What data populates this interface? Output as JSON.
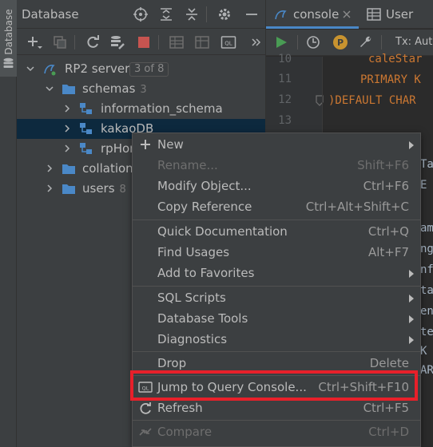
{
  "strip": {
    "label": "Database"
  },
  "db_panel": {
    "title": "Database",
    "tree": {
      "server": {
        "label": "RP2 server",
        "badge": "3 of 8"
      },
      "schemas": {
        "label": "schemas",
        "count": "3"
      },
      "items": [
        {
          "label": "information_schema"
        },
        {
          "label": "kakaoDB"
        },
        {
          "label": "rpHom"
        }
      ],
      "collations": {
        "label": "collations"
      },
      "users": {
        "label": "users",
        "count": "8"
      }
    }
  },
  "editor": {
    "tabs": [
      {
        "label": "console"
      },
      {
        "label": "User"
      }
    ],
    "tx_label": "Tx: Auto",
    "line_numbers": [
      "10",
      "11",
      "12",
      "13"
    ],
    "code_lines": [
      "caleStar",
      "PRIMARY K",
      ")DEFAULT CHAR"
    ],
    "peek_chars": [
      "Ta",
      "E",
      "am",
      "ng",
      "nf",
      "ta",
      "en",
      "te",
      "K",
      "AR"
    ]
  },
  "menu": {
    "items": [
      {
        "label": "New",
        "shortcut": "",
        "submenu": true,
        "disabled": false
      },
      {
        "label": "Rename...",
        "shortcut": "Shift+F6",
        "submenu": false,
        "disabled": true
      },
      {
        "label": "Modify Object...",
        "shortcut": "Ctrl+F6",
        "submenu": false,
        "disabled": false
      },
      {
        "label": "Copy Reference",
        "shortcut": "Ctrl+Alt+Shift+C",
        "submenu": false,
        "disabled": false
      },
      {
        "label": "Quick Documentation",
        "shortcut": "Ctrl+Q",
        "submenu": false,
        "disabled": false
      },
      {
        "label": "Find Usages",
        "shortcut": "Alt+F7",
        "submenu": false,
        "disabled": false
      },
      {
        "label": "Add to Favorites",
        "shortcut": "",
        "submenu": true,
        "disabled": false
      },
      {
        "label": "SQL Scripts",
        "shortcut": "",
        "submenu": true,
        "disabled": false
      },
      {
        "label": "Database Tools",
        "shortcut": "",
        "submenu": true,
        "disabled": false
      },
      {
        "label": "Diagnostics",
        "shortcut": "",
        "submenu": true,
        "disabled": false
      },
      {
        "label": "Drop",
        "shortcut": "Delete",
        "submenu": false,
        "disabled": false
      },
      {
        "label": "Jump to Query Console...",
        "shortcut": "Ctrl+Shift+F10",
        "submenu": false,
        "disabled": false
      },
      {
        "label": "Refresh",
        "shortcut": "Ctrl+F5",
        "submenu": false,
        "disabled": false
      },
      {
        "label": "Compare",
        "shortcut": "Ctrl+D",
        "submenu": false,
        "disabled": true
      }
    ],
    "highlight_color": "#e8202a"
  },
  "colors": {
    "accent": "#4a88c7",
    "run_green": "#499c54",
    "stop_red": "#c75450",
    "selection": "#0d293e"
  }
}
